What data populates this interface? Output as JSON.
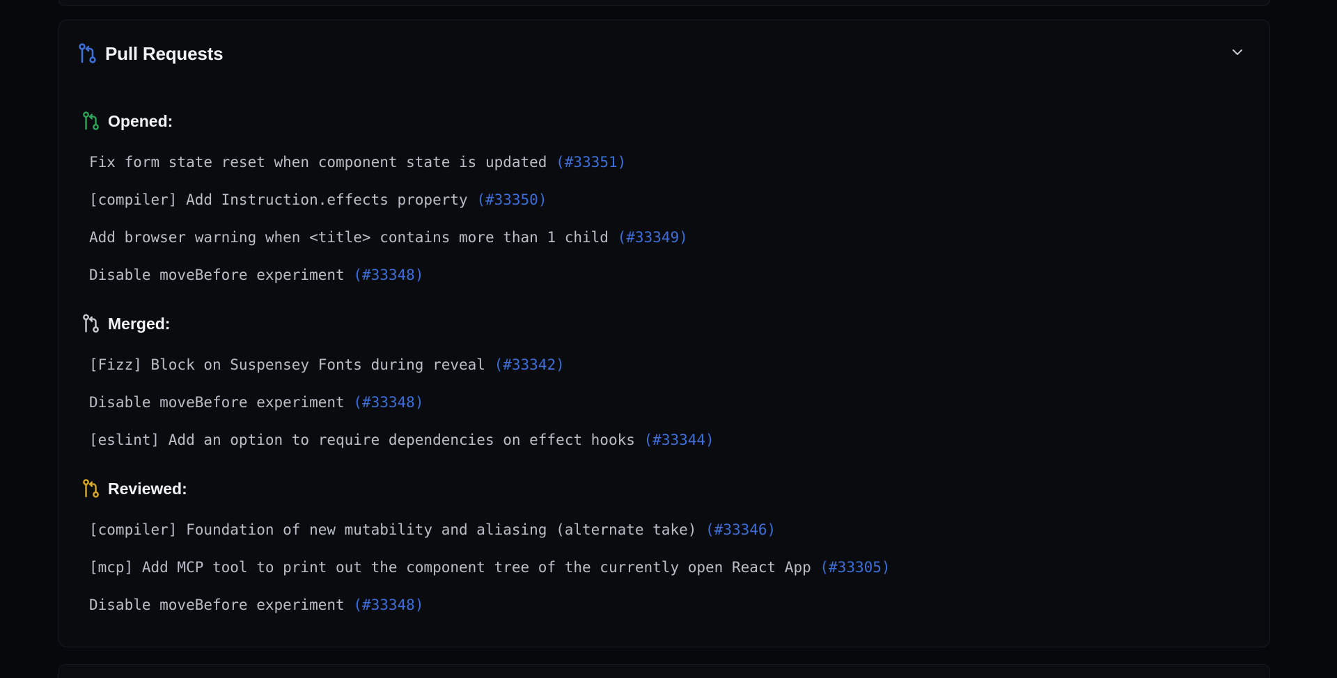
{
  "card": {
    "title": "Pull Requests",
    "title_icon": "git-pull-request-icon",
    "collapse_icon": "chevron-down-icon"
  },
  "colors": {
    "accent_blue": "#3f6ed6",
    "opened_green": "#2fa35a",
    "merged_gray": "#c9cdd4",
    "reviewed_yellow": "#d9a92a"
  },
  "sections": [
    {
      "label": "Opened:",
      "icon": "git-pull-request-icon",
      "items": [
        {
          "title": "Fix form state reset when component state is updated",
          "number": "(#33351)"
        },
        {
          "title": "[compiler] Add Instruction.effects property",
          "number": "(#33350)"
        },
        {
          "title": "Add browser warning when <title> contains more than 1 child",
          "number": "(#33349)"
        },
        {
          "title": "Disable moveBefore experiment",
          "number": "(#33348)"
        }
      ]
    },
    {
      "label": "Merged:",
      "icon": "git-pull-request-icon",
      "items": [
        {
          "title": "[Fizz] Block on Suspensey Fonts during reveal",
          "number": "(#33342)"
        },
        {
          "title": "Disable moveBefore experiment",
          "number": "(#33348)"
        },
        {
          "title": "[eslint] Add an option to require dependencies on effect hooks",
          "number": "(#33344)"
        }
      ]
    },
    {
      "label": "Reviewed:",
      "icon": "git-pull-request-icon",
      "items": [
        {
          "title": "[compiler] Foundation of new mutability and aliasing (alternate take)",
          "number": "(#33346)"
        },
        {
          "title": "[mcp] Add MCP tool to print out the component tree of the currently open React App",
          "number": "(#33305)"
        },
        {
          "title": "Disable moveBefore experiment",
          "number": "(#33348)"
        }
      ]
    }
  ]
}
